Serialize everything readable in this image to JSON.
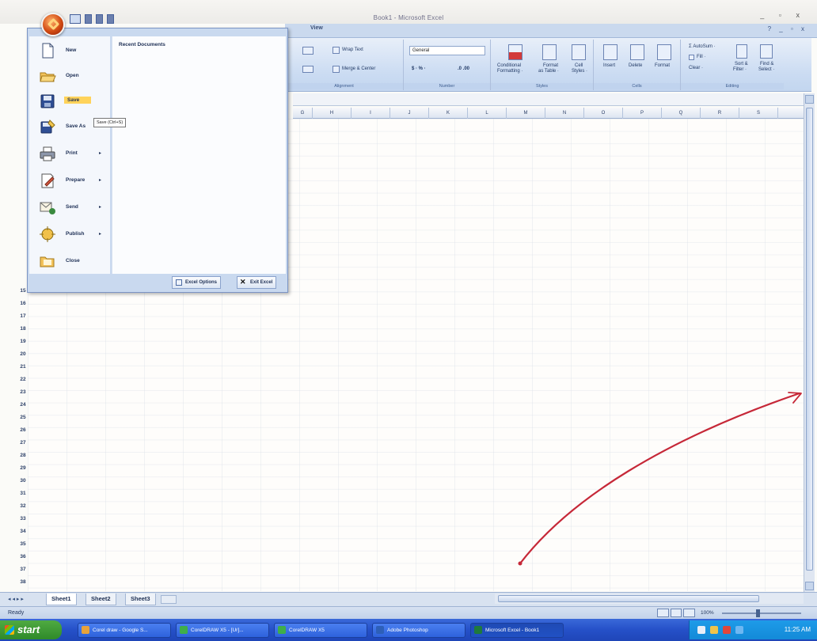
{
  "window": {
    "title": "Book1 - Microsoft Excel",
    "controls": "_ ▫ x"
  },
  "ribbon": {
    "visible_tab": "View",
    "help_controls": "? _ ▫ x",
    "alignment": {
      "wrap_text": "Wrap Text",
      "merge_center": "Merge & Center",
      "group_label": "Alignment"
    },
    "number": {
      "format_value": "General",
      "currency": "$ · % ·",
      "decimals": ".0 .00",
      "group_label": "Number"
    },
    "styles": {
      "conditional": [
        "Conditional",
        "Formatting ·"
      ],
      "format_table": [
        "Format",
        "as Table ·"
      ],
      "cell_styles": [
        "Cell",
        "Styles ·"
      ],
      "group_label": "Styles"
    },
    "cells": {
      "insert": "Insert",
      "delete": "Delete",
      "format": "Format",
      "group_label": "Cells"
    },
    "editing": {
      "autosum": "Σ AutoSum ·",
      "fill": "Fill ·",
      "clear": "Clear ·",
      "sort_filter": [
        "Sort &",
        "Filter ·"
      ],
      "find_select": [
        "Find &",
        "Select ·"
      ],
      "group_label": "Editing"
    }
  },
  "columns": [
    "G",
    "H",
    "I",
    "J",
    "K",
    "L",
    "M",
    "N",
    "O",
    "P",
    "Q",
    "R",
    "S"
  ],
  "rows": [
    "15",
    "16",
    "17",
    "18",
    "19",
    "20",
    "21",
    "22",
    "23",
    "24",
    "25",
    "26",
    "27",
    "28",
    "29",
    "30",
    "31",
    "32",
    "33",
    "34",
    "35",
    "36",
    "37",
    "38"
  ],
  "office_menu": {
    "recent_documents_title": "Recent Documents",
    "items": [
      {
        "label": "New",
        "icon": "new-document-icon",
        "has_submenu": false
      },
      {
        "label": "Open",
        "icon": "open-folder-icon",
        "has_submenu": false
      },
      {
        "label": "Save",
        "icon": "save-disk-icon",
        "has_submenu": false,
        "highlighted": true
      },
      {
        "label": "Save As",
        "icon": "save-as-icon",
        "has_submenu": true
      },
      {
        "label": "Print",
        "icon": "printer-icon",
        "has_submenu": true
      },
      {
        "label": "Prepare",
        "icon": "prepare-icon",
        "has_submenu": true
      },
      {
        "label": "Send",
        "icon": "send-icon",
        "has_submenu": true
      },
      {
        "label": "Publish",
        "icon": "publish-icon",
        "has_submenu": true
      },
      {
        "label": "Close",
        "icon": "close-folder-icon",
        "has_submenu": false
      }
    ],
    "tooltip": "Save (Ctrl+S)",
    "excel_options": "Excel Options",
    "exit_excel": "Exit Excel"
  },
  "sheets": {
    "nav": "◂ ◂ ▸ ▸",
    "tabs": [
      "Sheet1",
      "Sheet2",
      "Sheet3"
    ],
    "active": 0
  },
  "status": {
    "ready": "Ready",
    "zoom": "100%"
  },
  "taskbar": {
    "start_label": "start",
    "items": [
      {
        "label": "Corel draw - Google S...",
        "color": "#e8a23b"
      },
      {
        "label": "CorelDRAW X5 - [Ur]...",
        "color": "#3fae49"
      },
      {
        "label": "CorelDRAW X5",
        "color": "#3fae49"
      },
      {
        "label": "Adobe Photoshop",
        "color": "#2d5fb8"
      },
      {
        "label": "Microsoft Excel - Book1",
        "color": "#1f7a3c",
        "active": true
      }
    ],
    "clock": "11:25 AM"
  },
  "colors": {
    "annotation_arrow": "#c62838",
    "selected_menu_item": "#ffd35a",
    "ribbon_background": "#cadbf2"
  }
}
